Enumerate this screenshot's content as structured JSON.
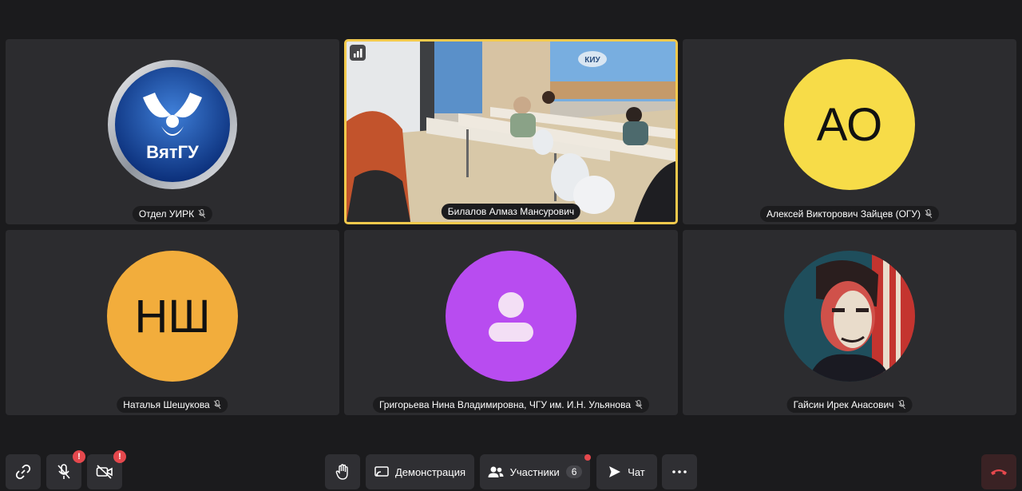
{
  "participants": [
    {
      "name": "Отдел УИРК",
      "logo_text": "ВятГУ",
      "muted": true
    },
    {
      "name": "Билалов Алмаз Мансурович",
      "speaking": true,
      "room_sign": "КИУ"
    },
    {
      "name": "Алексей Викторович Зайцев (ОГУ)",
      "initials": "АО",
      "color": "#f7dc48",
      "muted": true
    },
    {
      "name": "Наталья Шешукова",
      "initials": "НШ",
      "color": "#f2ad3c",
      "muted": true
    },
    {
      "name": "Григорьева Нина Владимировна, ЧГУ им. И.Н. Ульянова",
      "color": "#b84cf0",
      "muted": true
    },
    {
      "name": "Гайсин Ирек Анасович",
      "muted": true
    }
  ],
  "toolbar": {
    "mic_badge": "!",
    "camera_badge": "!",
    "screen_share_label": "Демонстрация",
    "participants_label": "Участники",
    "participants_count": "6",
    "chat_label": "Чат"
  },
  "colors": {
    "background": "#1b1b1d",
    "tile": "#2c2c2f",
    "speaking_border": "#f2c94c",
    "hangup": "#3a2224",
    "alert": "#e5484d"
  }
}
